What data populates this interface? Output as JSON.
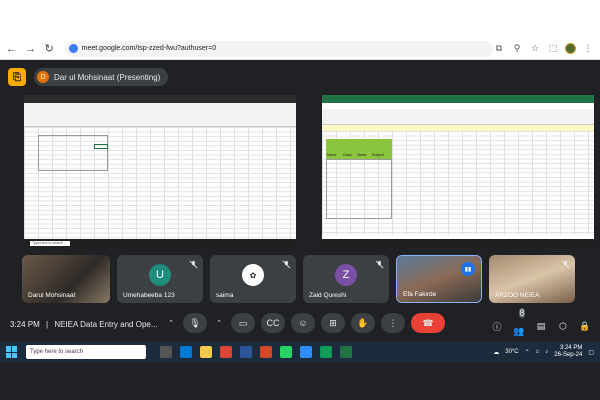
{
  "browser": {
    "url": "meet.google.com/tsp-zzed-fwu?authuser=0"
  },
  "meet": {
    "presenter": {
      "initial": "D",
      "label": "Dar ul Mohsinaat (Presenting)"
    },
    "time": "3:24 PM",
    "separator": "|",
    "meeting_title": "NEIEA Data Entry and Ope...",
    "participants_badge": "8",
    "participants": [
      {
        "name": "Darul Mohsinaat"
      },
      {
        "name": "Umehabeeba 123",
        "initial": "U",
        "color": "#1e8e7e"
      },
      {
        "name": "saima"
      },
      {
        "name": "Zaid Qureshi",
        "initial": "Z",
        "color": "#7b4fa3"
      },
      {
        "name": "Efa Fakirde"
      },
      {
        "name": "ARZOO NEIEA"
      }
    ]
  },
  "screen_right": {
    "headers": [
      "Name",
      "Class",
      "Marks",
      "Subject"
    ]
  },
  "taskbar": {
    "search_placeholder": "Type here to search",
    "temperature": "30°C",
    "clock_time": "3:24 PM",
    "clock_date": "26-Sep-24"
  }
}
